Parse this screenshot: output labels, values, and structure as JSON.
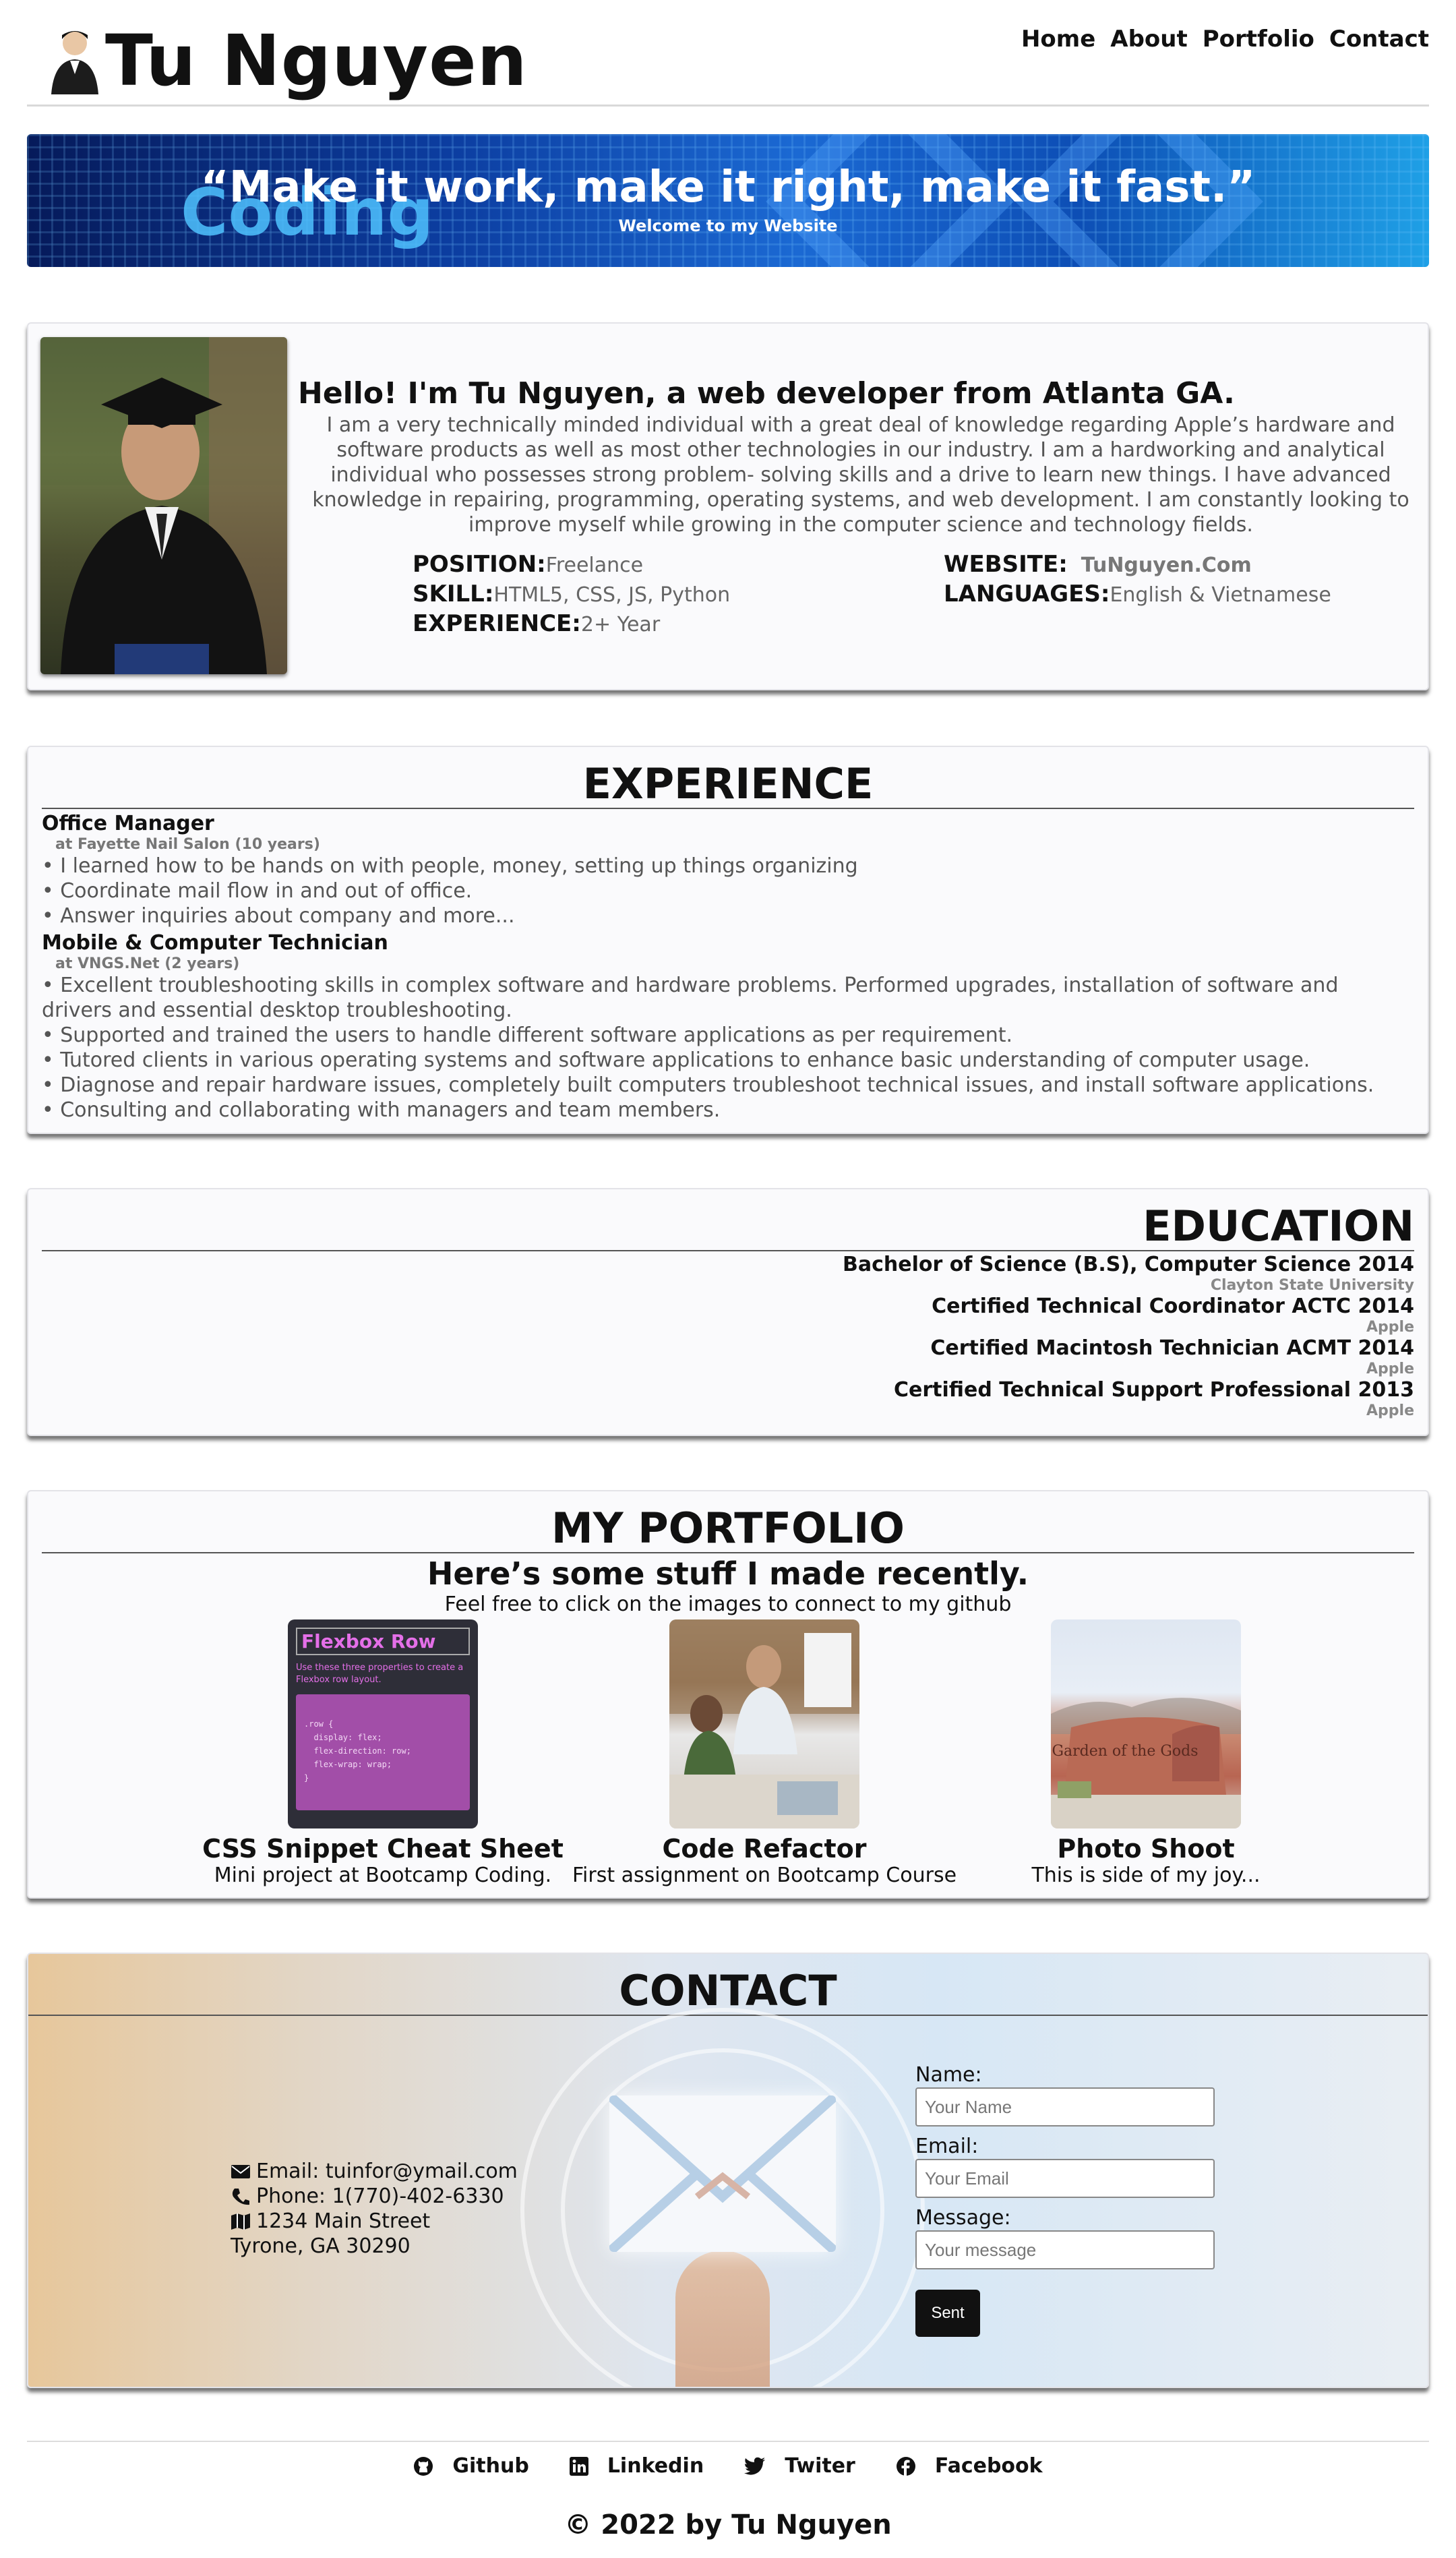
{
  "header": {
    "name": "Tu Nguyen",
    "nav": [
      "Home",
      "About",
      "Portfolio",
      "Contact"
    ]
  },
  "banner": {
    "background_word": "Coding",
    "quote": "“Make it work, make it right, make it fast.”",
    "subtitle": "Welcome to my Website"
  },
  "about": {
    "heading": "Hello! I'm Tu Nguyen, a web developer from Atlanta GA.",
    "text": "I am a very technically minded individual with a great deal of knowledge regarding Apple’s hardware and software products as well as most other technologies in our industry. I am a hardworking and analytical individual who possesses strong problem- solving skills and a drive to learn new things. I have advanced knowledge in repairing, programming, operating systems, and web development. I am constantly looking to improve myself while growing in the computer science and technology fields.",
    "position_label": "POSITION:",
    "position": "Freelance",
    "skill_label": "SKILL:",
    "skill": "HTML5, CSS, JS, Python",
    "experience_label": "EXPERIENCE:",
    "experience": "2+ Year",
    "website_label": "WEBSITE:",
    "website": "TuNguyen.Com",
    "languages_label": "LANGUAGES:",
    "languages": "English & Vietnamese"
  },
  "experience": {
    "title": "EXPERIENCE",
    "jobs": [
      {
        "title": "Office Manager",
        "subtitle": "at Fayette Nail Salon (10 years)",
        "bullets": [
          "• I learned how to be hands on with people, money, setting up things organizing",
          "• Coordinate mail flow in and out of office.",
          "• Answer inquiries about company and more..."
        ]
      },
      {
        "title": "Mobile & Computer Technician",
        "subtitle": "at VNGS.Net (2 years)",
        "bullets": [
          "• Excellent troubleshooting skills in complex software and hardware problems. Performed upgrades, installation of software and drivers and essential desktop troubleshooting.",
          "• Supported and trained the users to handle different software applications as per requirement.",
          "• Tutored clients in various operating systems and software applications to enhance basic understanding of computer usage.",
          "• Diagnose and repair hardware issues, completely built computers troubleshoot technical issues, and install software applications.",
          "• Consulting and collaborating with managers and team members."
        ]
      }
    ]
  },
  "education": {
    "title": "EDUCATION",
    "items": [
      {
        "title": "Bachelor of Science (B.S), Computer Science 2014",
        "sub": "Clayton State University"
      },
      {
        "title": "Certified Technical Coordinator ACTC 2014",
        "sub": "Apple"
      },
      {
        "title": "Certified Macintosh Technician ACMT 2014",
        "sub": "Apple"
      },
      {
        "title": "Certified Technical Support Professional 2013",
        "sub": "Apple"
      }
    ]
  },
  "portfolio": {
    "title": "MY PORTFOLIO",
    "heading": "Here’s some stuff I made recently.",
    "subheading": "Feel free to click on the images to connect to my github",
    "items": [
      {
        "title": "CSS Snippet Cheat Sheet",
        "desc": "Mini project at Bootcamp Coding."
      },
      {
        "title": "Code Refactor",
        "desc": "First assignment on Bootcamp Course"
      },
      {
        "title": "Photo Shoot",
        "desc": "This is side of my joy..."
      }
    ],
    "thumb_css": {
      "title": "Flexbox Row",
      "desc": "Use these three properties to create a Flexbox row layout.",
      "code": [
        ".row {",
        "  display: flex;",
        "  flex-direction: row;",
        "  flex-wrap: wrap;",
        "}"
      ]
    },
    "thumb_garden_sign": "Garden of the Gods"
  },
  "contact": {
    "title": "CONTACT",
    "email": "Email: tuinfor@ymail.com",
    "phone": "Phone: 1(770)-402-6330",
    "street": "1234 Main Street",
    "city": "Tyrone, GA 30290",
    "form": {
      "name_label": "Name:",
      "name_placeholder": "Your Name",
      "email_label": "Email:",
      "email_placeholder": "Your Email",
      "message_label": "Message:",
      "message_placeholder": "Your message",
      "submit": "Sent"
    }
  },
  "footer": {
    "links": [
      "Github",
      "Linkedin",
      "Twiter",
      "Facebook"
    ],
    "copyright": "© 2022 by Tu Nguyen"
  }
}
